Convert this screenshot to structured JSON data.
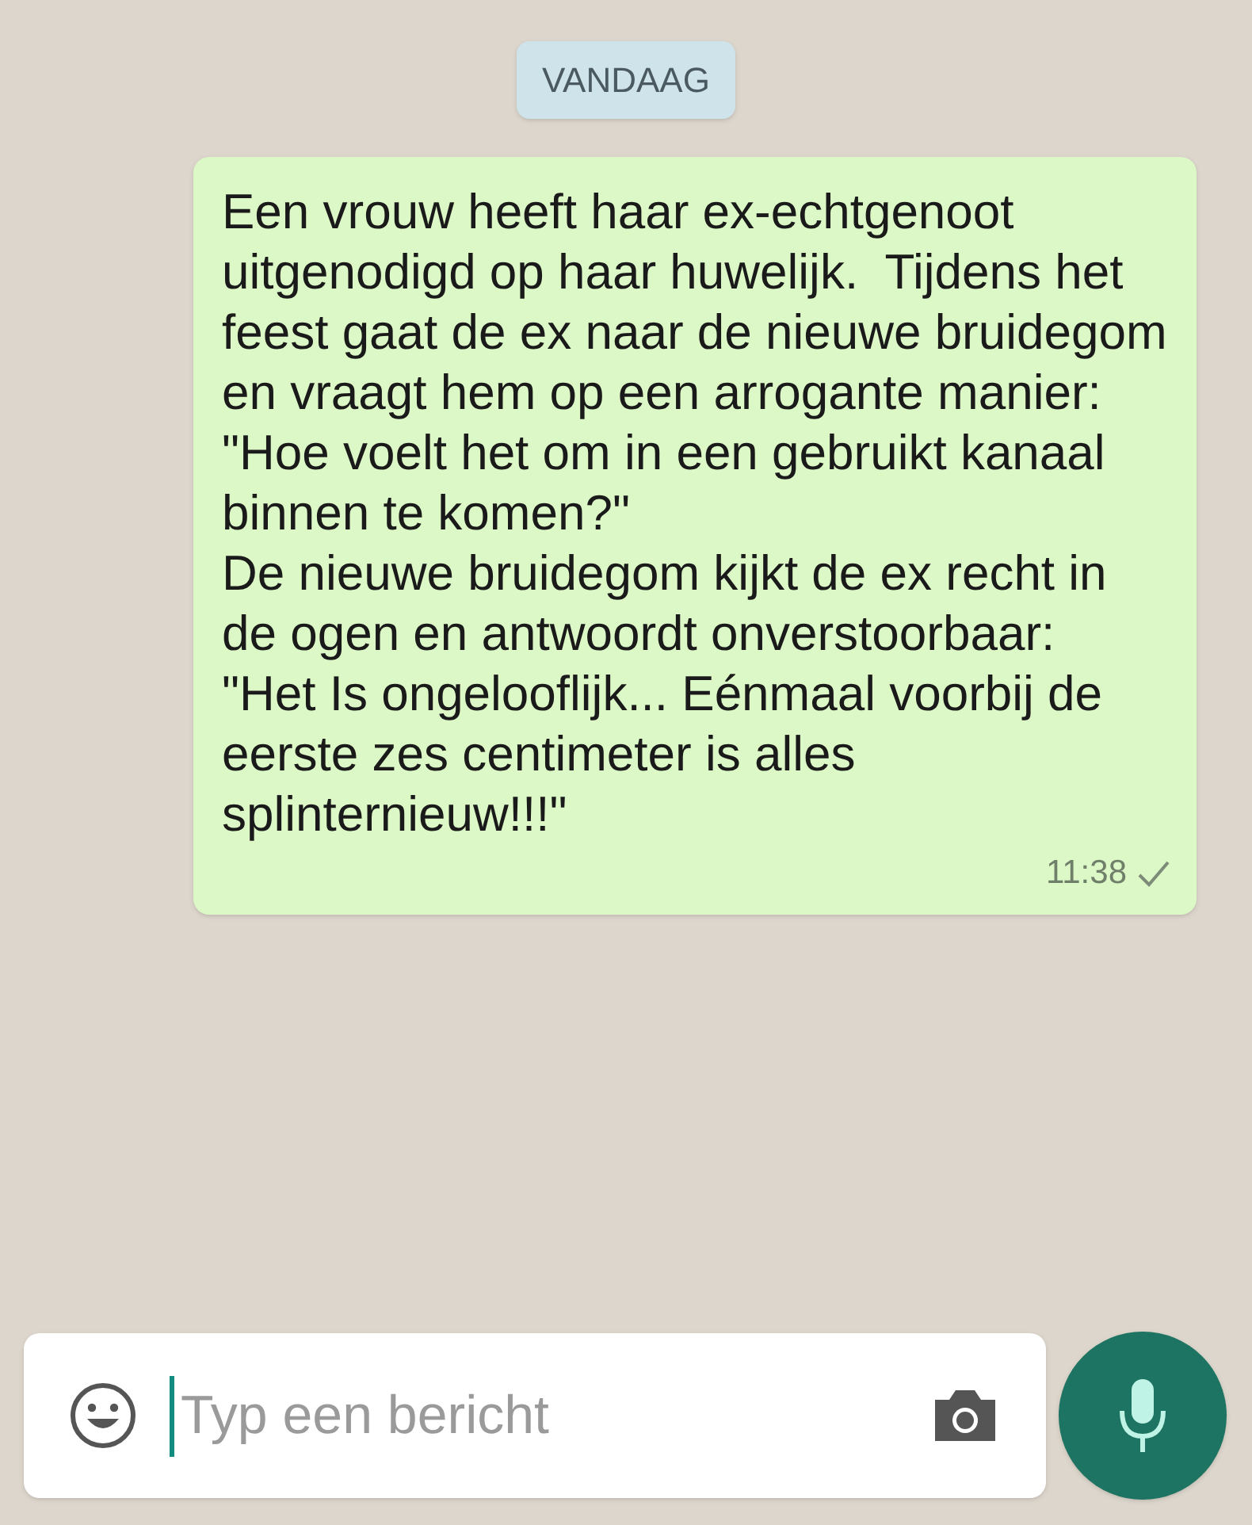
{
  "date_chip": "VANDAAG",
  "message": {
    "paragraphs": [
      "Een vrouw heeft haar ex-echtgenoot uitgenodigd op haar huwelijk.  Tijdens het feest gaat de ex naar de nieuwe bruidegom en vraagt hem op een arrogante manier:",
      "\"Hoe voelt het om in een gebruikt kanaal binnen te komen?\"",
      "De nieuwe bruidegom kijkt de ex recht in de ogen en antwoordt onverstoorbaar:",
      "\"Het Is ongelooflijk... Eénmaal voorbij de eerste zes centimeter is alles splinternieuw!!!\""
    ],
    "time": "11:38",
    "delivered": true
  },
  "composer": {
    "placeholder": "Typ een bericht"
  }
}
